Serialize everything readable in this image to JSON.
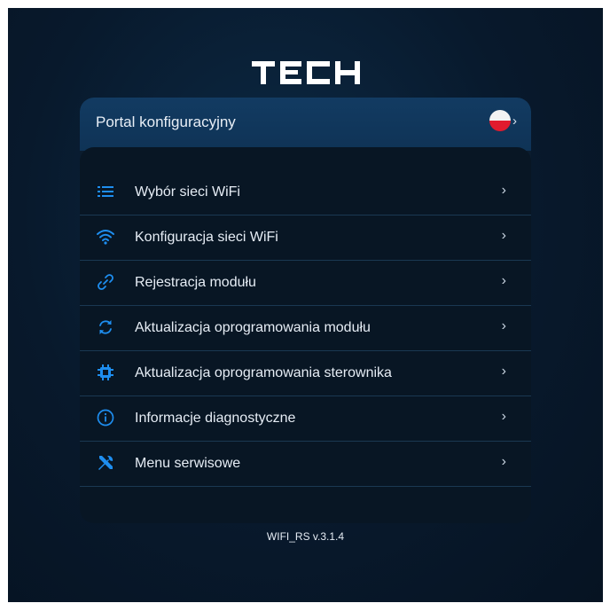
{
  "brand": {
    "logo_text": "TECH"
  },
  "header": {
    "title": "Portal konfiguracyjny",
    "language_icon": "poland-flag-icon",
    "language_chevron": "›"
  },
  "menu": {
    "items": [
      {
        "label": "Wybór sieci WiFi",
        "icon": "list-icon",
        "arrow": "›"
      },
      {
        "label": "Konfiguracja sieci WiFi",
        "icon": "wifi-icon",
        "arrow": "›"
      },
      {
        "label": "Rejestracja modułu",
        "icon": "link-icon",
        "arrow": "›"
      },
      {
        "label": "Aktualizacja oprogramowania modułu",
        "icon": "refresh-icon",
        "arrow": "›"
      },
      {
        "label": "Aktualizacja oprogramowania sterownika",
        "icon": "chip-icon",
        "arrow": "›"
      },
      {
        "label": "Informacje diagnostyczne",
        "icon": "info-icon",
        "arrow": "›"
      },
      {
        "label": "Menu serwisowe",
        "icon": "tools-icon",
        "arrow": "›"
      }
    ]
  },
  "footer": {
    "version": "WIFI_RS v.3.1.4"
  },
  "colors": {
    "accent": "#1e8ef0",
    "background": "#08192c",
    "header": "#123b62"
  }
}
